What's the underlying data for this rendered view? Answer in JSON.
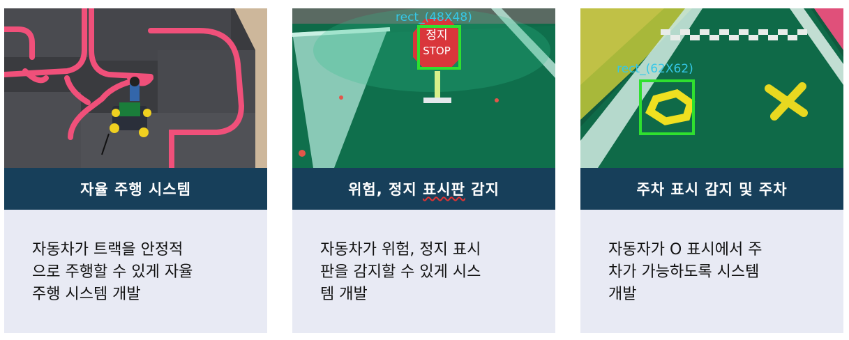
{
  "cards": [
    {
      "title": "자율 주행 시스템",
      "description": "자동차가 트랙을  안정적\n으로 주행할 수 있게 자율\n주행 시스템 개발"
    },
    {
      "title_main": "위험, 정지 ",
      "title_squiggle": "표시판",
      "title_end": " 감지",
      "description": "자동차가 위험, 정지 표시\n판을 감지할 수 있게 시스\n템 개발",
      "sign_top": "정지",
      "sign_bottom": "STOP",
      "detection_label": "rect_(48X48)"
    },
    {
      "title": "주차 표시 감지 및 주차",
      "description": "자동자가 O 표시에서 주\n차가 가능하도록 시스템\n개발",
      "detection_label": "rect_(62X62)"
    }
  ],
  "colors": {
    "title_bar": "#173f5a",
    "desc_bg": "#e8eaf4",
    "track_pink": "#f0507a",
    "mat_green": "#0f6f4c",
    "detect_green": "#2fe02f",
    "label_cyan": "#35c8e8"
  }
}
